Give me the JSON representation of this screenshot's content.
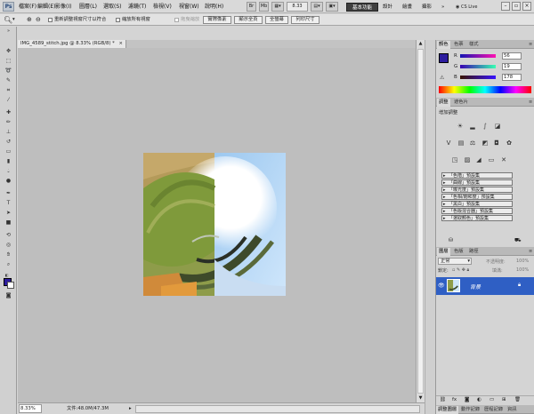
{
  "app": {
    "logo": "Ps"
  },
  "menu": [
    "檔案(F)",
    "編輯(E)",
    "影像(I)",
    "圖層(L)",
    "選取(S)",
    "濾鏡(T)",
    "檢視(V)",
    "視窗(W)",
    "說明(H)"
  ],
  "menubar_right": {
    "zoom": "8.33",
    "workspaces": [
      "基本功能",
      "設計",
      "繪畫",
      "攝影"
    ],
    "more": "»",
    "cs_live": "CS Live"
  },
  "options": {
    "resize_windows": "重新調整視窗尺寸以符合",
    "zoom_all": "縮放所有視窗",
    "scrubby_zoom": "拖曳縮放",
    "actual_pixels": "實際像素",
    "fit_screen": "顯示全頁",
    "fill_screen": "全螢幕",
    "print_size": "列印尺寸"
  },
  "document": {
    "tab_title": "IMG_4589_stitch.jpg @ 8.33% (RGB/8) *",
    "tab_close": "×"
  },
  "status": {
    "zoom": "8.33%",
    "doc_size": "文件:48.0M/47.3M"
  },
  "color_panel": {
    "tabs": [
      "顏色",
      "色票",
      "樣式"
    ],
    "r": 56,
    "g": 19,
    "b": 178,
    "foreground_hex": "#2c1c9e"
  },
  "adjustments_panel": {
    "tabs": [
      "調整",
      "遮色片"
    ],
    "title": "增加調整",
    "presets": [
      "「色階」預設集",
      "「曲線」預設集",
      "「曝光度」預設集",
      "「色相/飽和度」預設集",
      "「黑白」預設集",
      "「色版混合器」預設集",
      "「選取顏色」預設集"
    ]
  },
  "layers_panel": {
    "tabs": [
      "圖層",
      "色版",
      "路徑"
    ],
    "blend_mode": "正常",
    "opacity_label": "不透明度:",
    "opacity": "100%",
    "lock_label": "鎖定:",
    "fill_label": "填滿:",
    "fill": "100%",
    "layer_name": "背景",
    "bottom_tabs": [
      "調整圖層",
      "動作記錄",
      "歷程記錄",
      "資訊"
    ]
  },
  "colors": {
    "accent_blue": "#2f5fc4",
    "fg": "#2c1c9e"
  }
}
